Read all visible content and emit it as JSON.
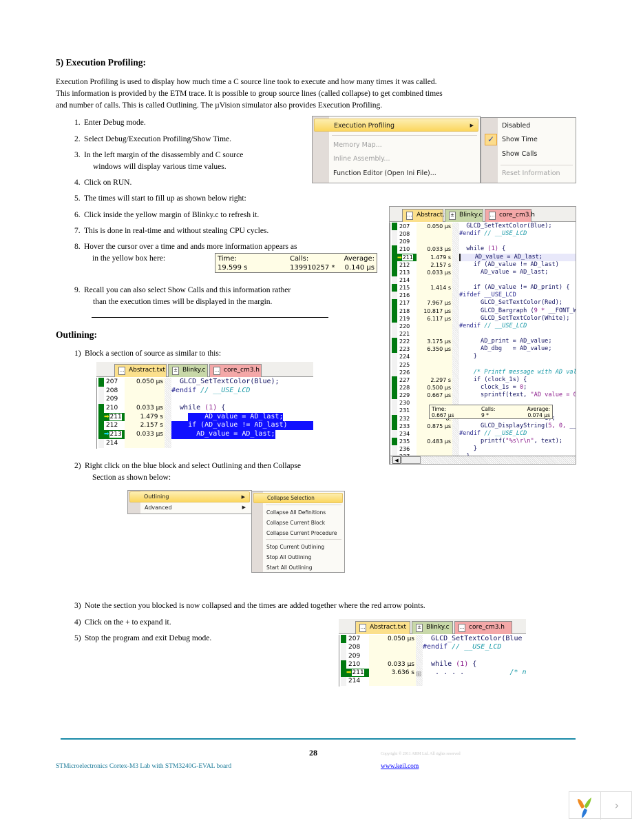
{
  "heading": "5)  Execution Profiling:",
  "intro": [
    "Execution Profiling is used to display how much time a C source line took to execute and how many times it was called.",
    "This information is provided by the ETM trace.  It is possible to group source lines (called collapse) to get combined times",
    "and number of calls. This is called Outlining.  The µVision simulator also provides Execution Profiling."
  ],
  "steps": [
    {
      "n": "1.",
      "text": "Enter Debug mode."
    },
    {
      "n": "2.",
      "text": "Select Debug/Execution Profiling/Show Time."
    },
    {
      "n": "3.",
      "text": "In the left margin of the disassembly and C source",
      "cont": "windows will display various time values."
    },
    {
      "n": "4.",
      "text": "Click on RUN."
    },
    {
      "n": "5.",
      "text": "The times will start to fill up as shown below right:"
    },
    {
      "n": "6.",
      "text": "Click inside the yellow margin of Blinky.c to refresh it."
    },
    {
      "n": "7.",
      "text": "This is done in real-time and without stealing CPU cycles."
    },
    {
      "n": "8.",
      "text": "Hover the cursor over a time and ands more information appears as",
      "cont": "in the yellow box here:"
    },
    {
      "n": "9.",
      "text": "Recall you can also select Show Calls and this information rather",
      "cont": "than the execution times will be displayed in the margin."
    }
  ],
  "tooltip1": {
    "time_label": "Time:",
    "calls_label": "Calls:",
    "avg_label": "Average:",
    "time": "19.599 s",
    "calls": "139910257 *",
    "avg": "0.140 µs"
  },
  "menu1": {
    "items": [
      {
        "label": "Execution Profiling",
        "state": "highlighted",
        "submenu": true
      },
      {
        "label": "Memory Map...",
        "state": "disabled"
      },
      {
        "label": "Inline Assembly...",
        "state": "disabled"
      },
      {
        "label": "Function Editor (Open Ini File)...",
        "state": "enabled"
      }
    ],
    "submenu": [
      {
        "label": "Disabled"
      },
      {
        "label": "Show Time",
        "checked": true
      },
      {
        "label": "Show Calls"
      },
      {
        "label": "Reset Information",
        "disabled": true
      }
    ]
  },
  "outlining_heading": "Outlining:",
  "outline_steps": [
    {
      "n": "1)",
      "text": "Block a section of source as similar to this:"
    },
    {
      "n": "2)",
      "text": "Right click on the blue block and select Outlining and then Collapse",
      "cont": "Section as shown below:"
    },
    {
      "n": "3)",
      "text": "Note the section you blocked is now collapsed and the times are added together where the red arrow points."
    },
    {
      "n": "4)",
      "text": "Click on the + to expand it."
    },
    {
      "n": "5)",
      "text": "Stop the program and exit Debug mode."
    }
  ],
  "menu2": {
    "items": [
      {
        "label": "Outlining",
        "highlighted": true
      },
      {
        "label": "Advanced"
      }
    ],
    "submenu": [
      "Collapse Selection",
      "Collapse All Definitions",
      "Collapse Current Block",
      "Collapse Current Procedure",
      "Stop Current Outlining",
      "Stop All Outlining",
      "Start All Outlining"
    ]
  },
  "tabs": [
    {
      "label": "Abstract.txt",
      "color": "#fbe08c"
    },
    {
      "label": "Blinky.c",
      "color": "#c8d8a8"
    },
    {
      "label": "core_cm3.h",
      "color": "#f4a8a8"
    }
  ],
  "panel_right": {
    "rows": [
      {
        "ln": "207",
        "t": "0.050 µs",
        "g": 1,
        "code": [
          [
            "  GLCD_SetTextColor(Blue);",
            "n"
          ]
        ]
      },
      {
        "ln": "208",
        "t": "",
        "g": 0,
        "code": [
          [
            "#endif ",
            "d"
          ],
          [
            "// __USE_LCD",
            "c"
          ]
        ]
      },
      {
        "ln": "209",
        "t": "",
        "g": 0,
        "code": []
      },
      {
        "ln": "210",
        "t": "0.033 µs",
        "g": 1,
        "code": [
          [
            "  while ",
            "n"
          ],
          [
            "(1)",
            "p"
          ],
          [
            " {",
            "n"
          ]
        ]
      },
      {
        "ln": "211",
        "t": "1.479 s",
        "g": 1,
        "arrow": "yellow",
        "cur": 1,
        "code": [
          [
            "    AD_value = AD_last;",
            "n"
          ]
        ]
      },
      {
        "ln": "212",
        "t": "2.157 s",
        "g": 1,
        "code": [
          [
            "    if (AD_value != AD_last)",
            "n"
          ]
        ]
      },
      {
        "ln": "213",
        "t": "0.033 µs",
        "g": 1,
        "code": [
          [
            "      AD_value = AD_last;",
            "n"
          ]
        ]
      },
      {
        "ln": "214",
        "t": "",
        "g": 0,
        "code": []
      },
      {
        "ln": "215",
        "t": "1.414 s",
        "g": 1,
        "code": [
          [
            "    if (AD_value != AD_print) {",
            "n"
          ]
        ]
      },
      {
        "ln": "216",
        "t": "",
        "g": 0,
        "code": [
          [
            "#ifdef __USE_LCD",
            "d"
          ]
        ]
      },
      {
        "ln": "217",
        "t": "7.967 µs",
        "g": 1,
        "code": [
          [
            "      GLCD_SetTextColor(Red);",
            "n"
          ]
        ]
      },
      {
        "ln": "218",
        "t": "10.817 µs",
        "g": 1,
        "code": [
          [
            "      GLCD_Bargraph (",
            "n"
          ],
          [
            "9 *",
            "p"
          ],
          [
            " __FONT_W",
            "n"
          ]
        ]
      },
      {
        "ln": "219",
        "t": "6.117 µs",
        "g": 1,
        "code": [
          [
            "      GLCD_SetTextColor(White);",
            "n"
          ]
        ]
      },
      {
        "ln": "220",
        "t": "",
        "g": 0,
        "code": [
          [
            "#endif ",
            "d"
          ],
          [
            "// __USE_LCD",
            "c"
          ]
        ]
      },
      {
        "ln": "221",
        "t": "",
        "g": 0,
        "code": []
      },
      {
        "ln": "222",
        "t": "3.175 µs",
        "g": 1,
        "code": [
          [
            "      AD_print = AD_value;",
            "n"
          ]
        ]
      },
      {
        "ln": "223",
        "t": "6.350 µs",
        "g": 1,
        "code": [
          [
            "      AD_dbg   = AD_value;",
            "n"
          ]
        ]
      },
      {
        "ln": "224",
        "t": "",
        "g": 0,
        "code": [
          [
            "    }",
            "n"
          ]
        ]
      },
      {
        "ln": "225",
        "t": "",
        "g": 0,
        "code": []
      },
      {
        "ln": "226",
        "t": "",
        "g": 0,
        "code": [
          [
            "    /* Printf message with AD val",
            "c"
          ]
        ]
      },
      {
        "ln": "227",
        "t": "2.297 s",
        "g": 1,
        "code": [
          [
            "    if (clock_1s) {",
            "n"
          ]
        ]
      },
      {
        "ln": "228",
        "t": "0.500 µs",
        "g": 1,
        "code": [
          [
            "      clock_1s = ",
            "n"
          ],
          [
            "0",
            "p"
          ],
          [
            ";",
            "n"
          ]
        ]
      },
      {
        "ln": "229",
        "t": "0.667 µs",
        "g": 1,
        "code": [
          [
            "      sprintf(text, ",
            "n"
          ],
          [
            "\"AD value = 0",
            "p"
          ]
        ]
      },
      {
        "ln": "230",
        "t": "",
        "g": 0,
        "code": []
      },
      {
        "ln": "231",
        "t": "",
        "g": 0,
        "code": []
      },
      {
        "ln": "232",
        "t": "0.",
        "g": 1,
        "code": [
          [
            "                        e);",
            "n"
          ]
        ]
      },
      {
        "ln": "233",
        "t": "0.875 µs",
        "g": 1,
        "code": [
          [
            "      GLCD_DisplayString(",
            "n"
          ],
          [
            "5, 0,",
            "p"
          ],
          [
            " __",
            "n"
          ]
        ]
      },
      {
        "ln": "234",
        "t": "",
        "g": 0,
        "code": [
          [
            "#endif ",
            "d"
          ],
          [
            "// __USE_LCD",
            "c"
          ]
        ]
      },
      {
        "ln": "235",
        "t": "0.483 µs",
        "g": 1,
        "code": [
          [
            "      printf(",
            "n"
          ],
          [
            "\"%s\\r\\n\"",
            "p"
          ],
          [
            ", text);",
            "n"
          ]
        ]
      },
      {
        "ln": "236",
        "t": "",
        "g": 0,
        "code": [
          [
            "    }",
            "n"
          ]
        ]
      },
      {
        "ln": "237",
        "t": "",
        "g": 0,
        "code": [
          [
            "  }",
            "n"
          ]
        ]
      }
    ],
    "tooltip": {
      "time_label": "Time:",
      "calls_label": "Calls:",
      "avg_label": "Average:",
      "time": "0.667 µs",
      "calls": "9 *",
      "avg": "0.074 µs"
    }
  },
  "panel_select": {
    "rows": [
      {
        "ln": "207",
        "t": "0.050 µs",
        "g": 1,
        "code": [
          [
            "  GLCD_SetTextColor(Blue);",
            "n"
          ]
        ]
      },
      {
        "ln": "208",
        "t": "",
        "g": 0,
        "code": [
          [
            "#endif ",
            "d"
          ],
          [
            "// __USE_LCD",
            "c"
          ]
        ]
      },
      {
        "ln": "209",
        "t": "",
        "g": 0,
        "code": []
      },
      {
        "ln": "210",
        "t": "0.033 µs",
        "g": 1,
        "code": [
          [
            "  while ",
            "n"
          ],
          [
            "(1)",
            "p"
          ],
          [
            " {",
            "n"
          ]
        ]
      },
      {
        "ln": "211",
        "t": "1.479 s",
        "g": 1,
        "arrow": "yellow",
        "sel": "part",
        "code": [
          [
            "    AD_value = AD_last;",
            "n"
          ]
        ]
      },
      {
        "ln": "212",
        "t": "2.157 s",
        "g": 1,
        "sel": "full",
        "code": [
          [
            "    if (AD_value != AD_last)",
            "n"
          ]
        ]
      },
      {
        "ln": "213",
        "t": "0.033 µs",
        "g": 1,
        "arrow": "cyan",
        "sel": "end",
        "code": [
          [
            "      AD_value = AD_last;",
            "n"
          ]
        ]
      },
      {
        "ln": "214",
        "t": "",
        "g": 0,
        "code": []
      }
    ]
  },
  "panel_collapsed": {
    "rows": [
      {
        "ln": "207",
        "t": "0.050 µs",
        "g": 1,
        "code": [
          [
            "  GLCD_SetTextColor(Blue",
            "n"
          ]
        ]
      },
      {
        "ln": "208",
        "t": "",
        "g": 0,
        "code": [
          [
            "#endif ",
            "d"
          ],
          [
            "// __USE_LCD",
            "c"
          ]
        ]
      },
      {
        "ln": "209",
        "t": "",
        "g": 0,
        "code": []
      },
      {
        "ln": "210",
        "t": "0.033 µs",
        "g": 1,
        "code": [
          [
            "  while ",
            "n"
          ],
          [
            "(1)",
            "p"
          ],
          [
            " {",
            "n"
          ]
        ]
      },
      {
        "ln": "211",
        "t": "3.636 s",
        "g": 1,
        "arrow": "yellow",
        "plus": 1,
        "code": [
          [
            "   . . . .           ",
            "n"
          ],
          [
            "/* no",
            "c"
          ]
        ]
      },
      {
        "ln": "214",
        "t": "",
        "g": 0,
        "code": []
      }
    ]
  },
  "footer": {
    "page": "28",
    "copyright": "Copyright © 2011 ARM Ltd. All rights reserved",
    "title": "STMicroelectronics Cortex-M3 Lab with STM3240G-EVAL board",
    "link": "www.keil.com",
    "rule_color": "#1a8aa8"
  },
  "colors": {
    "gutter_green": "#007a10",
    "time_margin": "#fffde6",
    "selection_blue": "#1010ff",
    "menu_highlight": "#fbd65e"
  }
}
